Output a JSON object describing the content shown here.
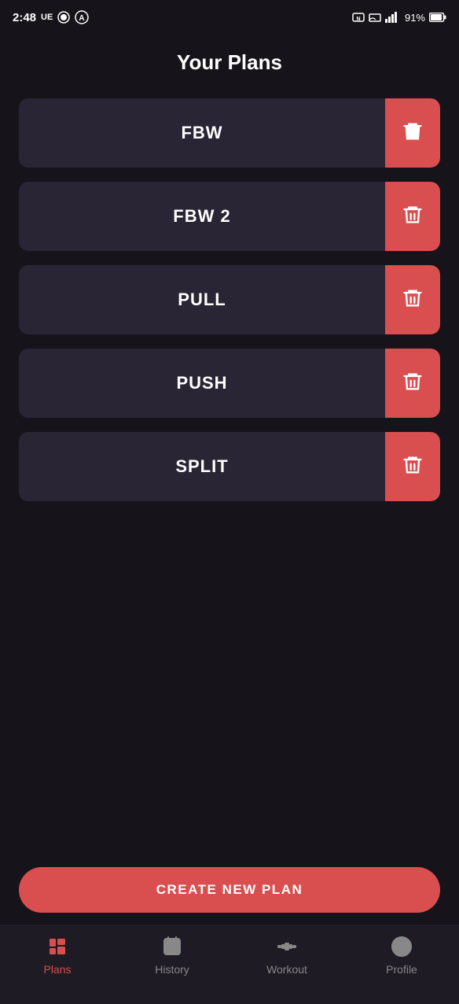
{
  "statusBar": {
    "time": "2:48",
    "leftIcons": [
      "UE"
    ],
    "battery": "91%"
  },
  "pageTitle": "Your Plans",
  "plans": [
    {
      "id": "fbw",
      "label": "FBW"
    },
    {
      "id": "fbw2",
      "label": "FBW 2"
    },
    {
      "id": "pull",
      "label": "PULL"
    },
    {
      "id": "push",
      "label": "PUSH"
    },
    {
      "id": "split",
      "label": "SPLIT"
    }
  ],
  "createButton": {
    "label": "CREATE NEW PLAN"
  },
  "bottomNav": [
    {
      "id": "plans",
      "label": "Plans",
      "active": true
    },
    {
      "id": "history",
      "label": "History",
      "active": false
    },
    {
      "id": "workout",
      "label": "Workout",
      "active": false
    },
    {
      "id": "profile",
      "label": "Profile",
      "active": false
    }
  ],
  "colors": {
    "accent": "#d94f4f",
    "background": "#16131a",
    "cardBg": "#2a2535",
    "navBg": "#1e1b24"
  }
}
